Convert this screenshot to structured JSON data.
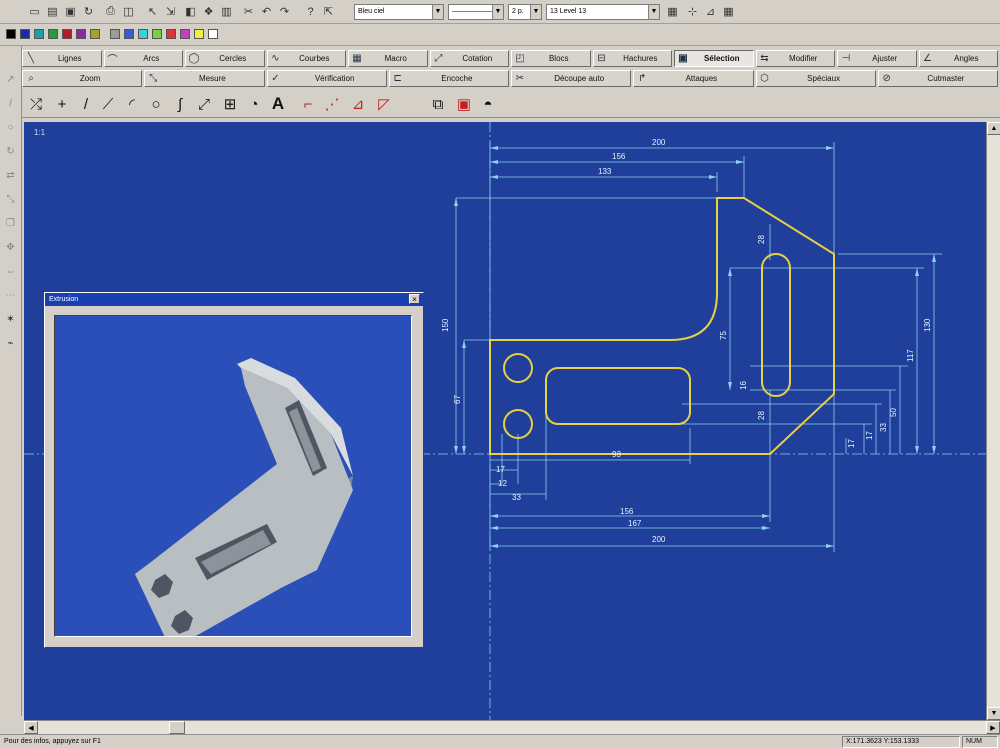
{
  "toolbar": {
    "color_combo": "Bleu ciel",
    "linetype_combo": "——————",
    "thickness_combo": "2 p.",
    "level_combo": "13 Level 13"
  },
  "palette": {
    "colors": [
      "#000000",
      "#1c2aa8",
      "#1aa0a8",
      "#2a9a3a",
      "#b01c2a",
      "#8a2aa0",
      "#a8a028",
      "#9c9c9c",
      "#3a5ad0",
      "#3ad0d8",
      "#78d040",
      "#e03040",
      "#c040c0",
      "#f0f040",
      "#ffffff"
    ]
  },
  "commands_row1": [
    {
      "label": "Lignes"
    },
    {
      "label": "Arcs"
    },
    {
      "label": "Cercles"
    },
    {
      "label": "Courbes"
    },
    {
      "label": "Macro"
    },
    {
      "label": "Cotation"
    },
    {
      "label": "Blocs"
    },
    {
      "label": "Hachures"
    },
    {
      "label": "Sélection"
    },
    {
      "label": "Modifier"
    },
    {
      "label": "Ajuster"
    },
    {
      "label": "Angles"
    }
  ],
  "commands_row2": [
    {
      "label": "Zoom"
    },
    {
      "label": "Mesure"
    },
    {
      "label": "Vérification"
    },
    {
      "label": "Encoche"
    },
    {
      "label": "Découpe auto"
    },
    {
      "label": "Attaques"
    },
    {
      "label": "Spéciaux"
    },
    {
      "label": "Cutmaster"
    }
  ],
  "canvas": {
    "view_label": "1:1",
    "dims": {
      "d200": "200",
      "d156": "156",
      "d133": "133",
      "v150": "150",
      "v67": "67",
      "v75": "75",
      "v28": "28",
      "v130": "130",
      "v117": "117",
      "v50": "50",
      "v33": "33",
      "v17a": "17",
      "v17b": "17",
      "s28": "28",
      "s16": "16",
      "b93": "93",
      "b17": "17",
      "b12": "12",
      "b33": "33",
      "b156": "156",
      "b167": "167",
      "b200": "200"
    }
  },
  "render_window": {
    "title": "Extrusion"
  },
  "status": {
    "hint": "Pour des infos, appuyez sur F1",
    "coords": "X:171.3623   Y:153.1333",
    "mode": "NUM"
  }
}
